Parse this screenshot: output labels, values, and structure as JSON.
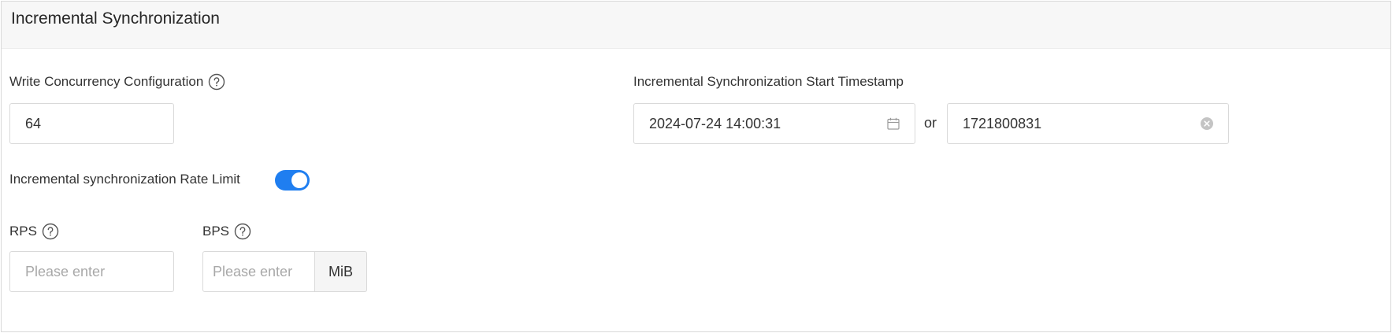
{
  "panel": {
    "title": "Incremental Synchronization"
  },
  "concurrency": {
    "label": "Write Concurrency Configuration",
    "value": "64",
    "help_icon": "question-circle-icon"
  },
  "start_timestamp": {
    "label": "Incremental Synchronization Start Timestamp",
    "datetime_value": "2024-07-24 14:00:31",
    "datetime_icon": "calendar-icon",
    "or_text": "or",
    "unix_value": "1721800831",
    "clear_icon": "clear-circle-icon"
  },
  "rate_limit": {
    "label": "Incremental synchronization Rate Limit",
    "enabled": true,
    "toggle_color": "#1f7ef0"
  },
  "rps": {
    "label": "RPS",
    "placeholder": "Please enter",
    "help_icon": "question-circle-icon"
  },
  "bps": {
    "label": "BPS",
    "placeholder": "Please enter",
    "unit": "MiB",
    "help_icon": "question-circle-icon"
  }
}
